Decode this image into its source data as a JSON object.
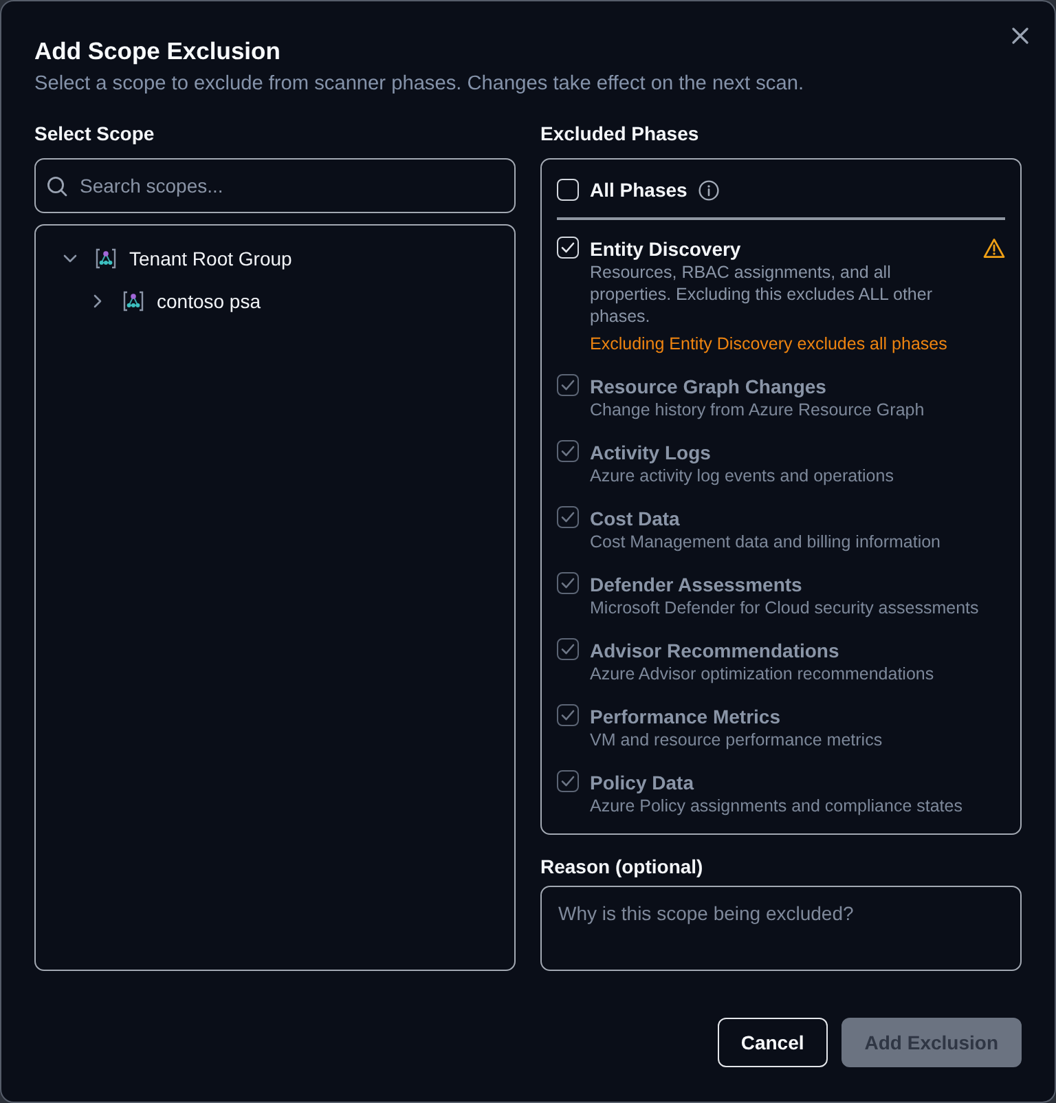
{
  "dialog": {
    "title": "Add Scope Exclusion",
    "subtitle": "Select a scope to exclude from scanner phases. Changes take effect on the next scan."
  },
  "scope": {
    "label": "Select Scope",
    "search": {
      "placeholder": "Search scopes..."
    },
    "tree": [
      {
        "label": "Tenant Root Group",
        "expanded": true,
        "children": [
          {
            "label": "contoso psa",
            "expanded": false
          }
        ]
      }
    ]
  },
  "phases": {
    "label": "Excluded Phases",
    "all": {
      "label": "All Phases",
      "checked": false
    },
    "items": [
      {
        "title": "Entity Discovery",
        "description": "Resources, RBAC assignments, and all properties. Excluding this excludes ALL other phases.",
        "warning": "Excluding Entity Discovery excludes all phases",
        "checked": true,
        "disabled": false
      },
      {
        "title": "Resource Graph Changes",
        "description": "Change history from Azure Resource Graph",
        "checked": true,
        "disabled": true
      },
      {
        "title": "Activity Logs",
        "description": "Azure activity log events and operations",
        "checked": true,
        "disabled": true
      },
      {
        "title": "Cost Data",
        "description": "Cost Management data and billing information",
        "checked": true,
        "disabled": true
      },
      {
        "title": "Defender Assessments",
        "description": "Microsoft Defender for Cloud security assessments",
        "checked": true,
        "disabled": true
      },
      {
        "title": "Advisor Recommendations",
        "description": "Azure Advisor optimization recommendations",
        "checked": true,
        "disabled": true
      },
      {
        "title": "Performance Metrics",
        "description": "VM and resource performance metrics",
        "checked": true,
        "disabled": true
      },
      {
        "title": "Policy Data",
        "description": "Azure Policy assignments and compliance states",
        "checked": true,
        "disabled": true
      }
    ]
  },
  "reason": {
    "label": "Reason (optional)",
    "placeholder": "Why is this scope being excluded?"
  },
  "buttons": [
    {
      "label": "Cancel",
      "kind": "secondary",
      "disabled": false
    },
    {
      "label": "Add Exclusion",
      "kind": "primary",
      "disabled": true
    }
  ]
}
